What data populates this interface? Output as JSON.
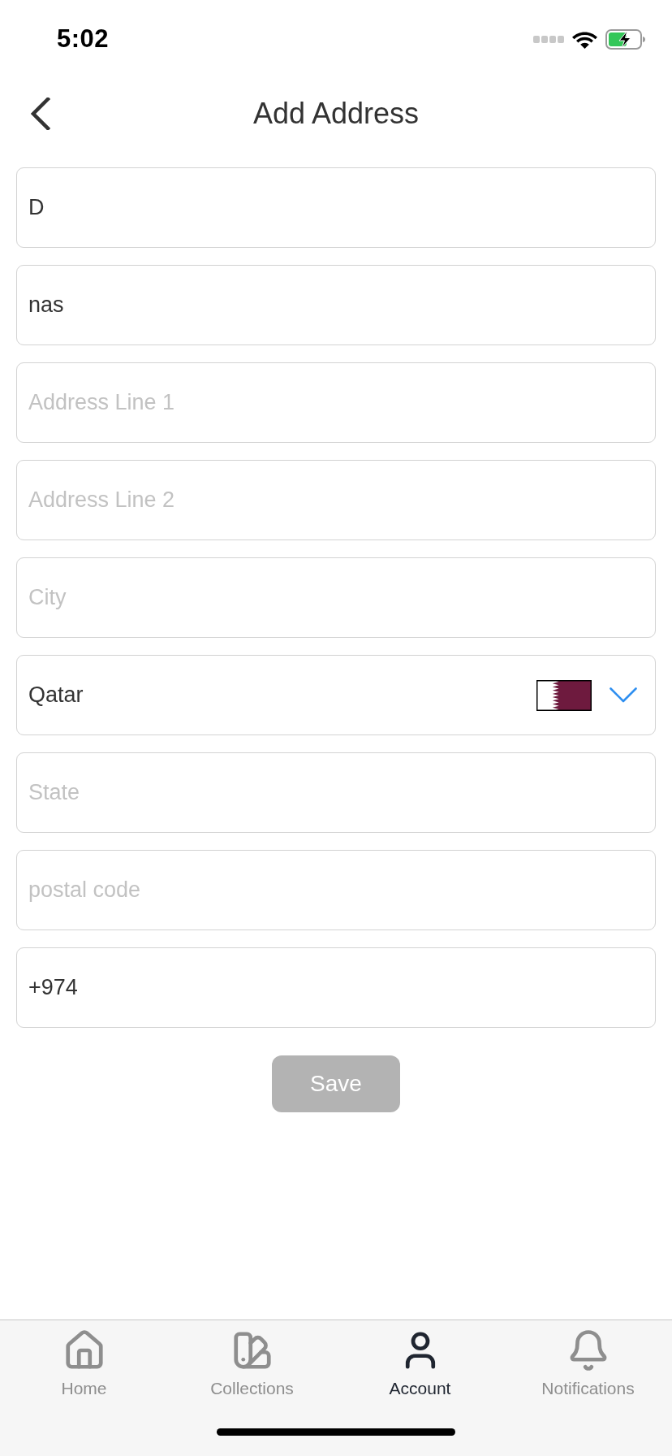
{
  "status_bar": {
    "time": "5:02"
  },
  "header": {
    "title": "Add Address"
  },
  "fields": [
    {
      "kind": "text",
      "value": "D"
    },
    {
      "kind": "text",
      "value": "nas"
    },
    {
      "kind": "text",
      "placeholder": "Address Line 1"
    },
    {
      "kind": "text",
      "placeholder": "Address Line 2"
    },
    {
      "kind": "text",
      "placeholder": "City"
    },
    {
      "kind": "country",
      "value": "Qatar"
    },
    {
      "kind": "text",
      "placeholder": "State"
    },
    {
      "kind": "text",
      "placeholder": "postal code"
    },
    {
      "kind": "text",
      "value": "+974"
    }
  ],
  "save_button": {
    "label": "Save",
    "disabled": true
  },
  "tab_bar": {
    "items": [
      {
        "kind": "home",
        "label": "Home",
        "selected": false
      },
      {
        "kind": "collections",
        "label": "Collections",
        "selected": false
      },
      {
        "kind": "account",
        "label": "Account",
        "selected": true
      },
      {
        "kind": "notifications",
        "label": "Notifications",
        "selected": false
      }
    ]
  }
}
